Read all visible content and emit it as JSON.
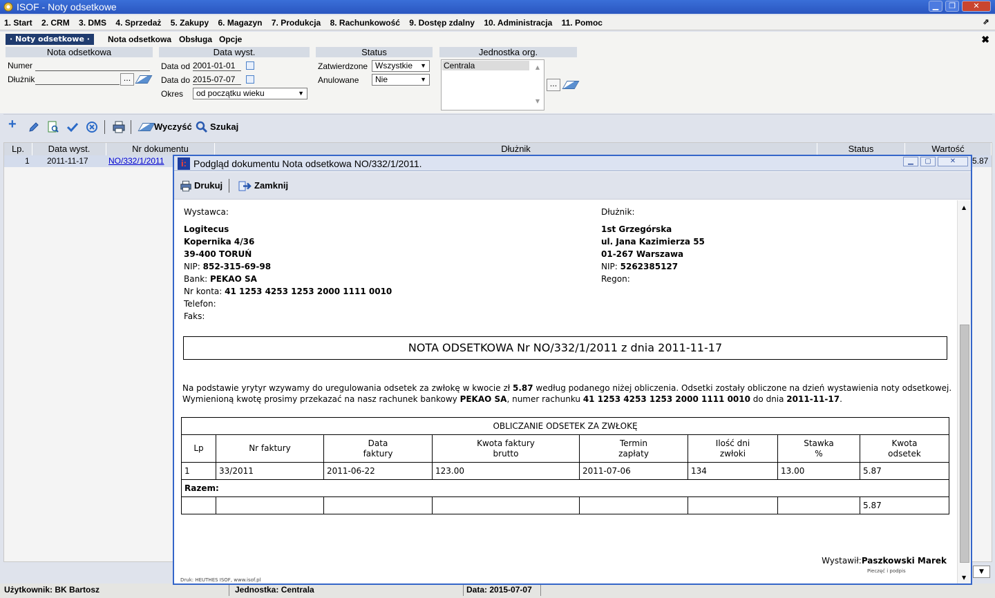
{
  "window": {
    "title": "ISOF - Noty odsetkowe"
  },
  "menu": [
    "1. Start",
    "2. CRM",
    "3. DMS",
    "4. Sprzedaż",
    "5. Zakupy",
    "6. Magazyn",
    "7. Produkcja",
    "8. Rachunkowość",
    "9. Dostęp zdalny",
    "10. Administracja",
    "11. Pomoc"
  ],
  "submenu": {
    "active": "· Noty odsetkowe ·",
    "items": [
      "Nota odsetkowa",
      "Obsługa",
      "Opcje"
    ]
  },
  "filters": {
    "nota": {
      "header": "Nota odsetkowa",
      "numer_label": "Numer",
      "numer_value": "",
      "dluznik_label": "Dłużnik",
      "dluznik_value": "",
      "browse": "..."
    },
    "data": {
      "header": "Data wyst.",
      "od_label": "Data od",
      "od_value": "2001-01-01",
      "do_label": "Data do",
      "do_value": "2015-07-07",
      "okres_label": "Okres",
      "okres_value": "od początku wieku"
    },
    "status": {
      "header": "Status",
      "zatw_label": "Zatwierdzone",
      "zatw_value": "Wszystkie",
      "anul_label": "Anulowane",
      "anul_value": "Nie"
    },
    "jednostka": {
      "header": "Jednostka org.",
      "items": [
        "Centrala"
      ],
      "browse": "..."
    }
  },
  "toolbar": {
    "clear": "Wyczyść",
    "search": "Szukaj"
  },
  "grid": {
    "columns": [
      "Lp.",
      "Data wyst.",
      "Nr dokumentu",
      "Dłużnik",
      "Status",
      "Wartość"
    ],
    "rows": [
      {
        "lp": "1",
        "date": "2011-11-17",
        "nr": "NO/332/1/2011",
        "value": "5.87"
      }
    ]
  },
  "statusbar": {
    "user_label": "Użytkownik:",
    "user": "BK Bartosz",
    "unit_label": "Jednostka:",
    "unit": "Centrala",
    "date_label": "Data:",
    "date": "2015-07-07"
  },
  "dialog": {
    "title": "Podgląd dokumentu Nota odsetkowa NO/332/1/2011.",
    "print": "Drukuj",
    "close": "Zamknij",
    "issuer_label": "Wystawca:",
    "issuer": {
      "name": "Logitecus",
      "street": "Kopernika 4/36",
      "city": "39-400 TORUŃ",
      "nip_label": "NIP:",
      "nip": "852-315-69-98",
      "bank_label": "Bank:",
      "bank": "PEKAO SA",
      "account_label": "Nr konta:",
      "account": "41 1253 4253 1253 2000 1111 0010",
      "phone_label": "Telefon:",
      "fax_label": "Faks:"
    },
    "debtor_label": "Dłużnik:",
    "debtor": {
      "name": "1st Grzegórska",
      "street": "ul. Jana Kazimierza 55",
      "city": "01-267 Warszawa",
      "nip_label": "NIP:",
      "nip": "5262385127",
      "regon_label": "Regon:"
    },
    "doc_title": "NOTA ODSETKOWA Nr NO/332/1/2011 z dnia 2011-11-17",
    "para1_a": "Na podstawie yrytyr wzywamy do uregulowania odsetek za zwłokę w kwocie zł ",
    "para1_amount": "5.87",
    "para1_b": " według podanego niżej obliczenia. Odsetki zostały obliczone na dzień wystawienia noty odsetkowej.",
    "para2_a": "Wymienioną kwotę prosimy przekazać na nasz rachunek bankowy ",
    "para2_bank": "PEKAO SA",
    "para2_b": ", numer rachunku ",
    "para2_account": "41 1253 4253 1253 2000 1111 0010",
    "para2_c": " do dnia ",
    "para2_date": "2011-11-17",
    "para2_d": ".",
    "calc_title": "OBLICZANIE ODSETEK ZA ZWŁOKĘ",
    "calc_headers": [
      [
        "Lp"
      ],
      [
        "Nr faktury"
      ],
      [
        "Data",
        "faktury"
      ],
      [
        "Kwota faktury",
        "brutto"
      ],
      [
        "Termin",
        "zapłaty"
      ],
      [
        "Ilość dni",
        "zwłoki"
      ],
      [
        "Stawka",
        "%"
      ],
      [
        "Kwota",
        "odsetek"
      ]
    ],
    "calc_row": [
      "1",
      "33/2011",
      "2011-06-22",
      "123.00",
      "2011-07-06",
      "134",
      "13.00",
      "5.87"
    ],
    "razem_label": "Razem:",
    "razem_value": "5.87",
    "issued_label": "Wystawił:",
    "issued_by": "Paszkowski Marek",
    "stamp_label": "Pieczęć i podpis",
    "footer": "Druk: HEUTHES ISOF, www.isof.pl"
  }
}
